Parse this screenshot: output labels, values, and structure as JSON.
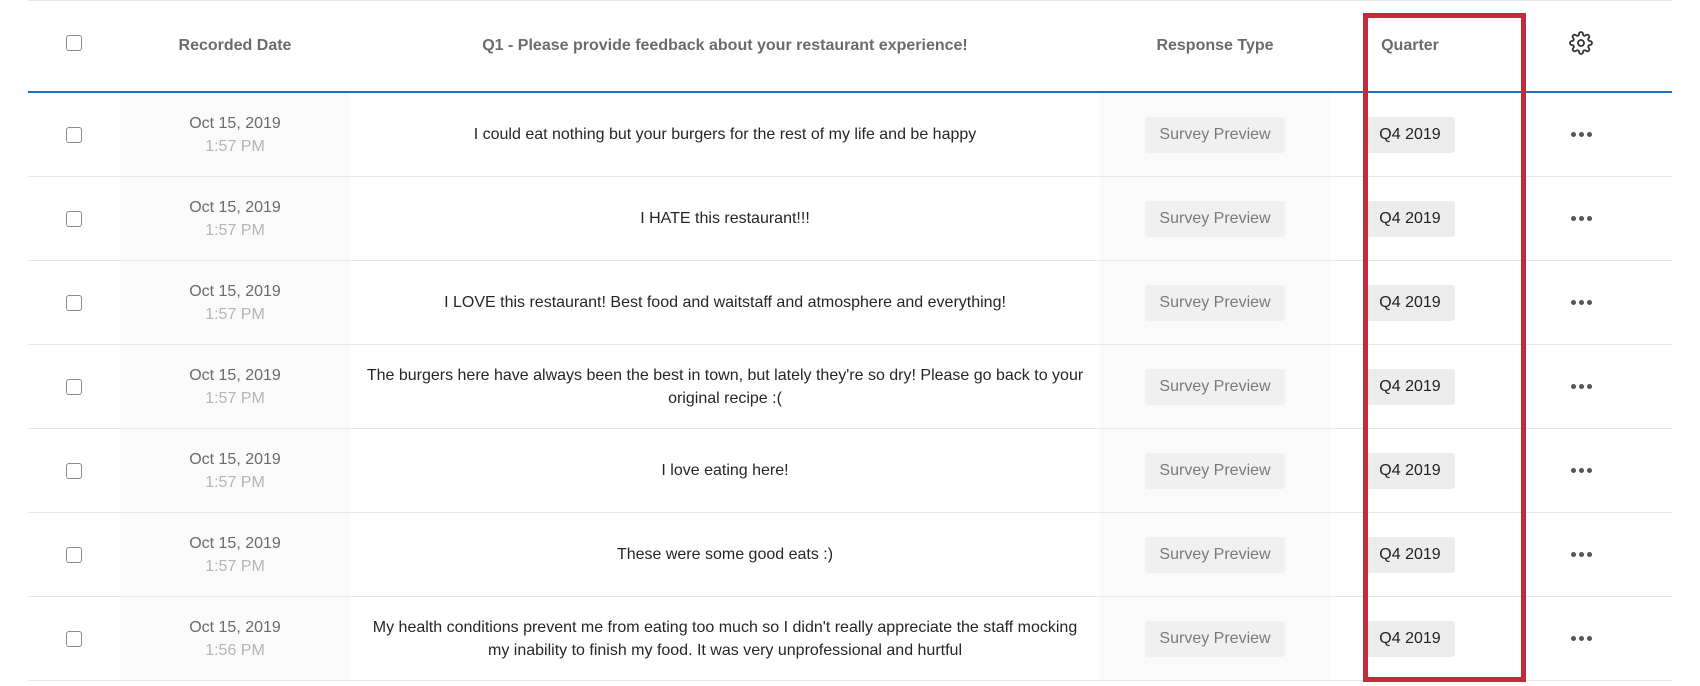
{
  "columns": {
    "recorded_date": "Recorded Date",
    "q1": "Q1 - Please provide feedback about your restaurant experience!",
    "response_type": "Response Type",
    "quarter": "Quarter"
  },
  "icons": {
    "settings": "gear-icon",
    "row_actions": "more-horizontal-icon",
    "select": "checkbox-icon"
  },
  "colors": {
    "header_underline": "#1b6ec2",
    "highlight": "#c22b3a",
    "badge_bg": "#ececec"
  },
  "rows": [
    {
      "date": "Oct 15, 2019",
      "time": "1:57 PM",
      "q1": "I could eat nothing but your burgers for the rest of my life and be happy",
      "response_type": "Survey Preview",
      "quarter": "Q4 2019"
    },
    {
      "date": "Oct 15, 2019",
      "time": "1:57 PM",
      "q1": "I HATE this restaurant!!!",
      "response_type": "Survey Preview",
      "quarter": "Q4 2019"
    },
    {
      "date": "Oct 15, 2019",
      "time": "1:57 PM",
      "q1": "I LOVE this restaurant! Best food and waitstaff and atmosphere and everything!",
      "response_type": "Survey Preview",
      "quarter": "Q4 2019"
    },
    {
      "date": "Oct 15, 2019",
      "time": "1:57 PM",
      "q1": "The burgers here have always been the best in town, but lately they're so dry! Please go back to your original recipe :(",
      "response_type": "Survey Preview",
      "quarter": "Q4 2019"
    },
    {
      "date": "Oct 15, 2019",
      "time": "1:57 PM",
      "q1": "I love eating here!",
      "response_type": "Survey Preview",
      "quarter": "Q4 2019"
    },
    {
      "date": "Oct 15, 2019",
      "time": "1:57 PM",
      "q1": "These were some good eats :)",
      "response_type": "Survey Preview",
      "quarter": "Q4 2019"
    },
    {
      "date": "Oct 15, 2019",
      "time": "1:56 PM",
      "q1": "My health conditions prevent me from eating too much so I didn't really appreciate the staff mocking my inability to finish my food. It was very unprofessional and hurtful",
      "response_type": "Survey Preview",
      "quarter": "Q4 2019"
    }
  ]
}
